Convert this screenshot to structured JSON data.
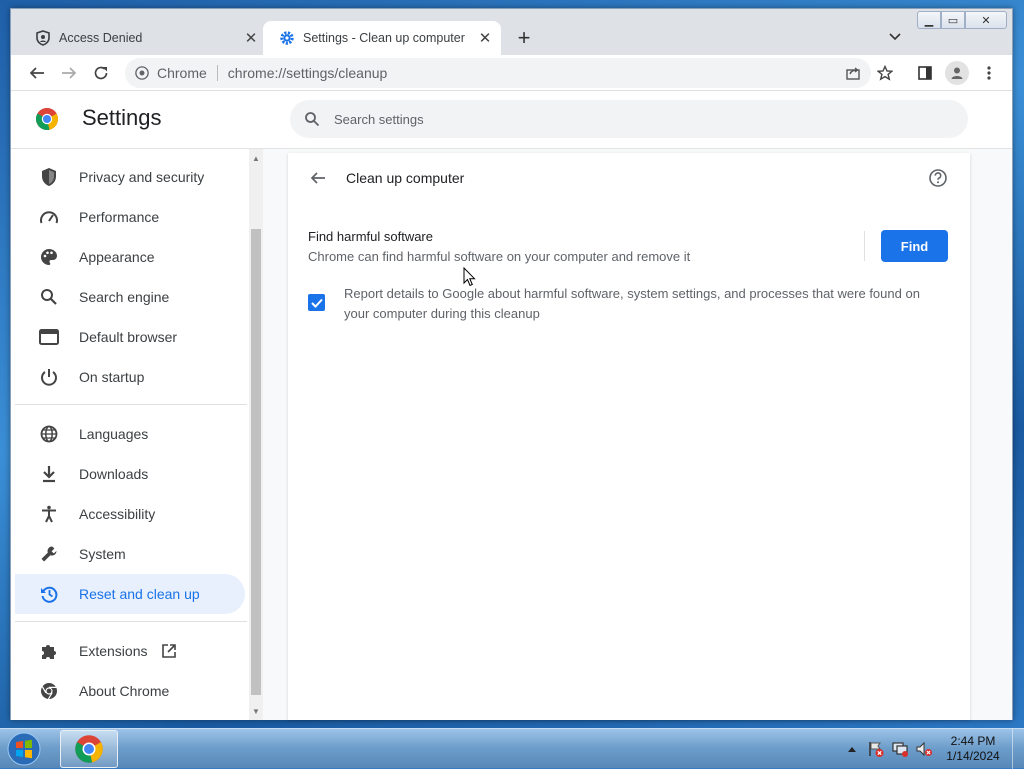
{
  "browser": {
    "tabs": [
      {
        "title": "Access Denied",
        "icon": "shield-person-icon",
        "active": false
      },
      {
        "title": "Settings - Clean up computer",
        "icon": "gear-icon",
        "active": true
      }
    ],
    "omnibox": {
      "chip": "Chrome",
      "url": "chrome://settings/cleanup"
    }
  },
  "settings": {
    "title": "Settings",
    "search_placeholder": "Search settings",
    "nav": [
      {
        "label": "Privacy and security",
        "icon": "shield-icon"
      },
      {
        "label": "Performance",
        "icon": "speedometer-icon"
      },
      {
        "label": "Appearance",
        "icon": "palette-icon"
      },
      {
        "label": "Search engine",
        "icon": "search-icon"
      },
      {
        "label": "Default browser",
        "icon": "browser-window-icon"
      },
      {
        "label": "On startup",
        "icon": "power-icon"
      },
      {
        "label": "Languages",
        "icon": "globe-icon"
      },
      {
        "label": "Downloads",
        "icon": "download-icon"
      },
      {
        "label": "Accessibility",
        "icon": "accessibility-icon"
      },
      {
        "label": "System",
        "icon": "wrench-icon"
      },
      {
        "label": "Reset and clean up",
        "icon": "history-icon",
        "active": true
      },
      {
        "label": "Extensions",
        "icon": "puzzle-icon"
      },
      {
        "label": "About Chrome",
        "icon": "chrome-icon"
      }
    ],
    "page": {
      "title": "Clean up computer",
      "harmful_title": "Find harmful software",
      "harmful_desc": "Chrome can find harmful software on your computer and remove it",
      "find_label": "Find",
      "report_label": "Report details to Google about harmful software, system settings, and processes that were found on your computer during this cleanup",
      "report_checked": true
    }
  },
  "taskbar": {
    "time": "2:44 PM",
    "date": "1/14/2024"
  },
  "colors": {
    "accent": "#1a73e8",
    "active_nav_bg": "#e8f0fe"
  }
}
